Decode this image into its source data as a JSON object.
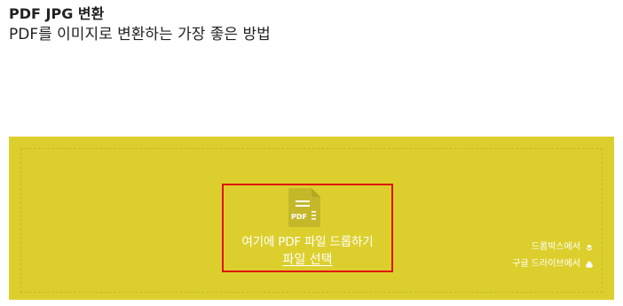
{
  "header": {
    "title": "PDF JPG 변환",
    "subtitle": "PDF를 이미지로 변환하는 가장 좋은 방법"
  },
  "dropzone": {
    "background_color": "#dccf2d",
    "highlight_color": "#e01010",
    "icon": "pdf-file-icon",
    "icon_label": "PDF",
    "drop_text": "여기에 PDF 파일 드롭하기",
    "select_link": "파일 선택",
    "sources": [
      {
        "label": "드롭박스에서",
        "icon": "dropbox-icon"
      },
      {
        "label": "구글 드라이브에서",
        "icon": "google-drive-icon"
      }
    ]
  }
}
